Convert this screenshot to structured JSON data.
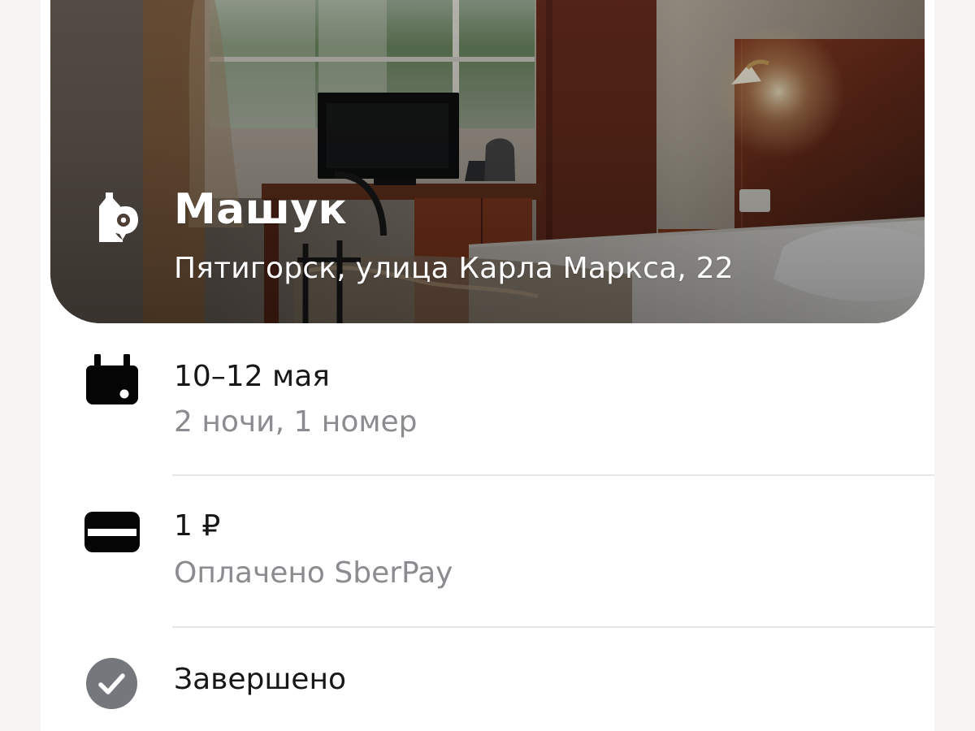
{
  "hotel": {
    "name": "Машук",
    "address": "Пятигорск, улица Карла Маркса, 22",
    "icon": "hotel-location-icon"
  },
  "stay": {
    "dates": "10–12 мая",
    "details": "2 ночи, 1 номер",
    "icon": "calendar-icon"
  },
  "payment": {
    "amount": "1 ₽",
    "method": "Оплачено SberPay",
    "icon": "payment-card-icon"
  },
  "status": {
    "label": "Завершено",
    "icon": "check-circle-icon"
  },
  "colors": {
    "primary_text": "#171717",
    "secondary_text": "#8b8c8f",
    "divider": "#e6e6e6",
    "status_icon": "#74787d",
    "background": "#f6f5f2"
  }
}
